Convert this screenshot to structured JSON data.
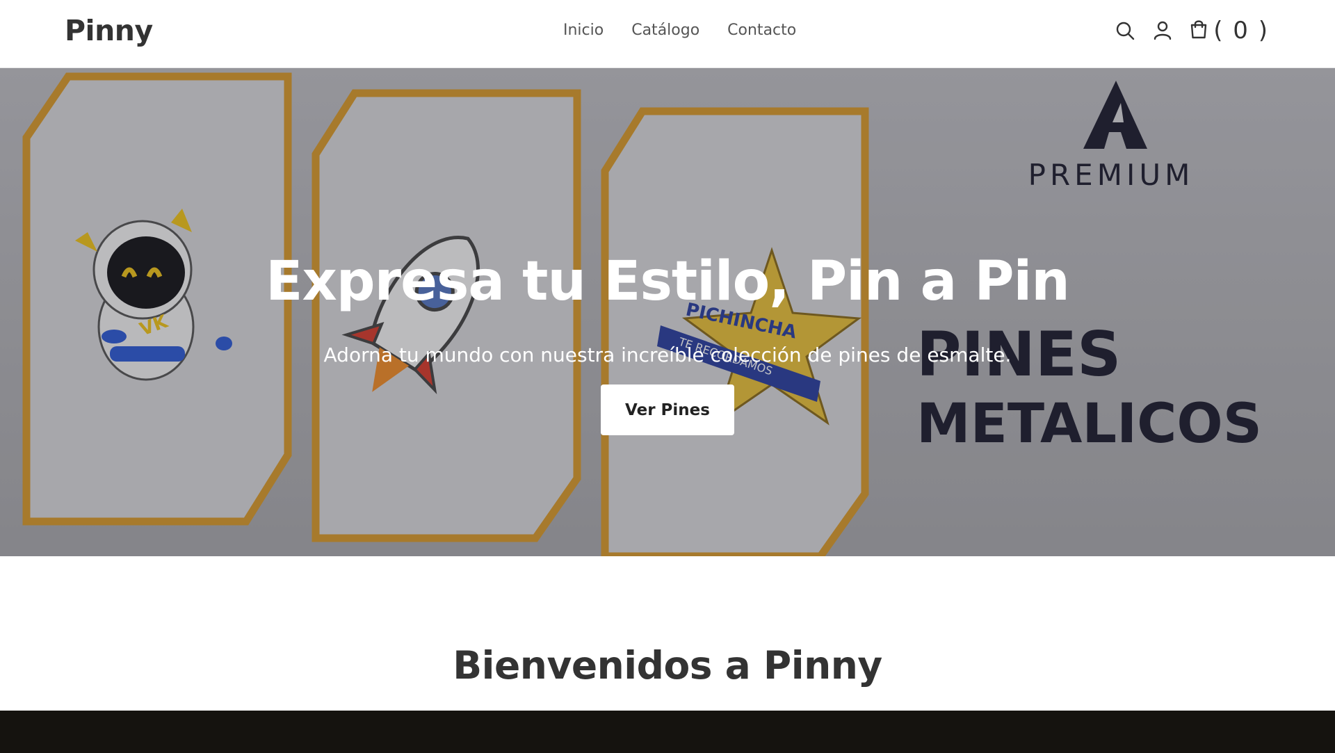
{
  "header": {
    "logo": "Pinny",
    "nav": [
      {
        "label": "Inicio"
      },
      {
        "label": "Catálogo"
      },
      {
        "label": "Contacto"
      }
    ],
    "cart_count": "( 0 )",
    "icons": [
      "search-icon",
      "user-icon",
      "cart-icon"
    ]
  },
  "hero": {
    "title": "Expresa tu Estilo, Pin a Pin",
    "subtitle": "Adorna tu mundo con nuestra increíble colección de pines de esmalte.",
    "button_label": "Ver Pines",
    "art": {
      "brand_text": "PREMIUM",
      "headline_line1": "PINES",
      "headline_line2": "METALICOS",
      "pin_star_text": "PICHINCHA",
      "pin_star_ribbon": "TE RECORDAMOS",
      "pin_astronaut_text": "VK"
    }
  },
  "welcome": {
    "title": "Bienvenidos a Pinny"
  },
  "colors": {
    "frame": "#d99a2b",
    "dark_text": "#1c1c2e",
    "footer": "#15130f"
  }
}
